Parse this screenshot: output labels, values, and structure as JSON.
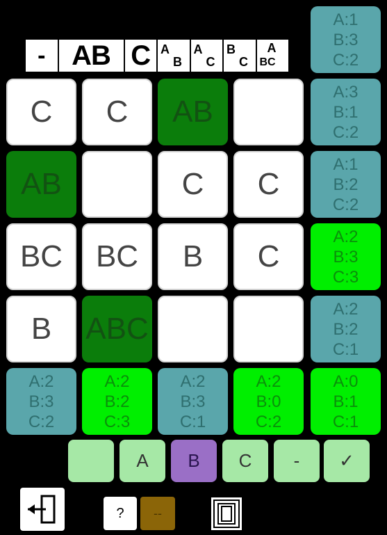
{
  "legend": [
    "-",
    "AB",
    "C",
    "A_B",
    "A_C",
    "B_C",
    "A_BC"
  ],
  "grid": [
    [
      {
        "text": "C",
        "state": "white"
      },
      {
        "text": "C",
        "state": "white"
      },
      {
        "text": "AB",
        "state": "dark"
      },
      {
        "text": "",
        "state": "white"
      }
    ],
    [
      {
        "text": "AB",
        "state": "dark"
      },
      {
        "text": "",
        "state": "white"
      },
      {
        "text": "C",
        "state": "white"
      },
      {
        "text": "C",
        "state": "white"
      }
    ],
    [
      {
        "text": "BC",
        "state": "white"
      },
      {
        "text": "BC",
        "state": "white"
      },
      {
        "text": "B",
        "state": "white"
      },
      {
        "text": "C",
        "state": "white"
      }
    ],
    [
      {
        "text": "B",
        "state": "white"
      },
      {
        "text": "ABC",
        "state": "dark"
      },
      {
        "text": "",
        "state": "white"
      },
      {
        "text": "",
        "state": "white"
      }
    ]
  ],
  "top_clue": {
    "a": "A:1",
    "b": "B:3",
    "c": "C:2",
    "state": "teal"
  },
  "row_clues": [
    {
      "a": "A:3",
      "b": "B:1",
      "c": "C:2",
      "state": "teal"
    },
    {
      "a": "A:1",
      "b": "B:2",
      "c": "C:2",
      "state": "teal"
    },
    {
      "a": "A:2",
      "b": "B:3",
      "c": "C:3",
      "state": "lime"
    },
    {
      "a": "A:2",
      "b": "B:2",
      "c": "C:1",
      "state": "teal"
    }
  ],
  "col_clues": [
    {
      "a": "A:2",
      "b": "B:3",
      "c": "C:2",
      "state": "teal"
    },
    {
      "a": "A:2",
      "b": "B:2",
      "c": "C:3",
      "state": "lime"
    },
    {
      "a": "A:2",
      "b": "B:3",
      "c": "C:1",
      "state": "teal"
    },
    {
      "a": "A:2",
      "b": "B:0",
      "c": "C:2",
      "state": "lime"
    },
    {
      "a": "A:0",
      "b": "B:1",
      "c": "C:1",
      "state": "lime"
    }
  ],
  "picker": [
    {
      "label": "",
      "style": "light"
    },
    {
      "label": "A",
      "style": "light"
    },
    {
      "label": "B",
      "style": "purple"
    },
    {
      "label": "C",
      "style": "light"
    },
    {
      "label": "-",
      "style": "light"
    },
    {
      "label": "✓",
      "style": "light"
    }
  ],
  "toolbar": {
    "exit_icon": "exit-door-icon",
    "help_label": "?",
    "toggle_label": "--",
    "frame_icon": "frame-icon",
    "colors": {
      "help_bg": "#ffffff",
      "toggle_bg": "#8b6508",
      "toggle_fg": "#4a3500"
    }
  }
}
